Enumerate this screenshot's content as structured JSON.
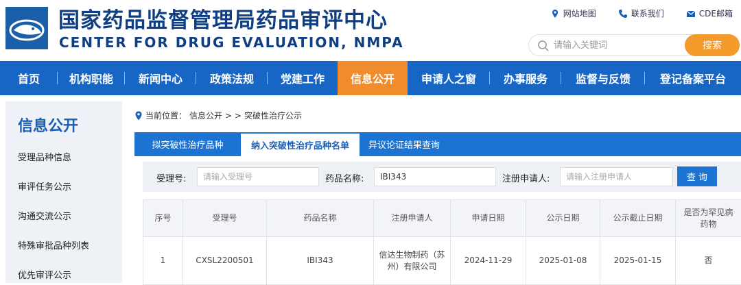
{
  "header": {
    "title_cn": "国家药品监督管理局药品审评中心",
    "title_en": "CENTER FOR DRUG EVALUATION, NMPA",
    "links": [
      {
        "label": "网站地图",
        "icon": "map-pin-icon"
      },
      {
        "label": "联系我们",
        "icon": "phone-icon"
      },
      {
        "label": "CDE邮箱",
        "icon": "mail-icon"
      }
    ],
    "search_placeholder": "请输入关键词",
    "search_button": "搜索"
  },
  "nav": {
    "items": [
      "首页",
      "机构职能",
      "新闻中心",
      "政策法规",
      "党建工作",
      "信息公开",
      "申请人之窗",
      "办事服务",
      "监督与反馈",
      "登记备案平台"
    ],
    "active_index": 5
  },
  "sidebar": {
    "title": "信息公开",
    "items": [
      "受理品种信息",
      "审评任务公示",
      "沟通交流公示",
      "特殊审批品种列表",
      "优先审评公示"
    ]
  },
  "breadcrumb": {
    "prefix": "当前位置：",
    "section": "信息公开",
    "separator": "> >",
    "page": "突破性治疗公示"
  },
  "tabs": {
    "items": [
      "拟突破性治疗品种",
      "纳入突破性治疗品种名单",
      "异议论证结果查询"
    ],
    "active_index": 1
  },
  "filter": {
    "accept_label": "受理号:",
    "accept_placeholder": "请输入受理号",
    "drug_label": "药品名称:",
    "drug_value": "IBI343",
    "applicant_label": "注册申请人:",
    "applicant_placeholder": "请输入注册申请人",
    "query_button": "查 询"
  },
  "table": {
    "headers": [
      "序号",
      "受理号",
      "药品名称",
      "注册申请人",
      "申请日期",
      "公示日期",
      "公示截止日期",
      "是否为罕见病药物"
    ],
    "rows": [
      [
        "1",
        "CXSL2200501",
        "IBI343",
        "信达生物制药（苏州）有限公司",
        "2024-11-29",
        "2025-01-08",
        "2025-01-15",
        "否"
      ]
    ]
  },
  "colors": {
    "brand_blue": "#0f3f82",
    "nav_blue": "#1766c6",
    "active_orange": "#f08c2b",
    "search_orange": "#f49a2a"
  }
}
